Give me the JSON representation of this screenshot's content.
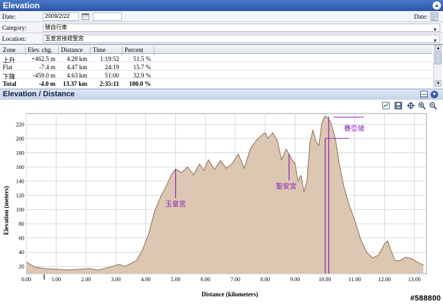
{
  "window": {
    "title": "Elevation"
  },
  "form": {
    "date_label": "Date:",
    "date_value": "2009/2/22",
    "date_right_label": "Date:",
    "category_label": "Category:",
    "category_value": "騎自行車",
    "location_label": "Location:",
    "location_value": "玉皇宮接趕聖宮"
  },
  "zones": {
    "headers": [
      "Zone",
      "Elev. chg.",
      "Distance",
      "Time",
      "Percent"
    ],
    "rows": [
      {
        "zone": "上升",
        "elev": "+462.5 m",
        "dist": "4.28 km",
        "time": "1:19:52",
        "pct": "51.5 %"
      },
      {
        "zone": "Flat",
        "elev": "-7.4 m",
        "dist": "4.47 km",
        "time": "24:19",
        "pct": "15.7 %"
      },
      {
        "zone": "下降",
        "elev": "-459.0 m",
        "dist": "4.63 km",
        "time": "51:00",
        "pct": "32.9 %"
      },
      {
        "zone": "Total",
        "elev": "-4.0 m",
        "dist": "13.37 km",
        "time": "2:35:11",
        "pct": "100.0 %"
      }
    ]
  },
  "chart_panel": {
    "title": "Elevation / Distance"
  },
  "chart_data": {
    "type": "area",
    "xlabel": "Distance (kilometers)",
    "ylabel": "Elevation (meters)",
    "xlim": [
      0,
      13.4
    ],
    "ylim": [
      10,
      235
    ],
    "x_ticks": [
      "0.00",
      "1.00",
      "2.00",
      "3.00",
      "4.00",
      "5.00",
      "6.00",
      "7.00",
      "8.00",
      "9.00",
      "10.00",
      "11.00",
      "12.00",
      "13.00"
    ],
    "y_ticks": [
      "20",
      "40",
      "60",
      "80",
      "100",
      "120",
      "140",
      "160",
      "180",
      "200",
      "220"
    ],
    "grid": true,
    "fill_color": "#dcc7b2",
    "line_color": "#8b6e52",
    "x": [
      0,
      0.3,
      0.6,
      1.0,
      1.4,
      1.8,
      2.1,
      2.4,
      2.7,
      2.9,
      3.1,
      3.3,
      3.5,
      3.7,
      3.9,
      4.1,
      4.3,
      4.5,
      4.7,
      4.85,
      5.0,
      5.2,
      5.4,
      5.6,
      5.8,
      5.95,
      6.1,
      6.3,
      6.5,
      6.7,
      6.9,
      7.1,
      7.3,
      7.5,
      7.7,
      7.9,
      8.0,
      8.1,
      8.25,
      8.4,
      8.55,
      8.7,
      8.8,
      8.9,
      9.0,
      9.1,
      9.2,
      9.3,
      9.4,
      9.5,
      9.6,
      9.7,
      9.8,
      9.9,
      10.0,
      10.1,
      10.2,
      10.35,
      10.5,
      10.65,
      10.8,
      11.0,
      11.2,
      11.4,
      11.6,
      11.8,
      11.9,
      12.0,
      12.1,
      12.2,
      12.35,
      12.5,
      12.7,
      12.9,
      13.1,
      13.3
    ],
    "y": [
      26,
      19,
      17,
      16,
      15,
      16,
      17,
      15,
      18,
      20,
      23,
      20,
      24,
      29,
      44,
      66,
      98,
      118,
      134,
      148,
      157,
      152,
      160,
      149,
      164,
      155,
      170,
      156,
      169,
      158,
      165,
      178,
      158,
      185,
      197,
      205,
      208,
      200,
      208,
      198,
      170,
      185,
      178,
      170,
      165,
      140,
      148,
      125,
      140,
      195,
      212,
      196,
      190,
      222,
      231,
      229,
      222,
      200,
      160,
      130,
      108,
      85,
      58,
      40,
      32,
      36,
      44,
      52,
      56,
      44,
      28,
      28,
      33,
      31,
      26,
      22
    ],
    "markers": [
      {
        "label": "玉皇宮",
        "x": 5.0,
        "y": 157
      },
      {
        "label": "聖安宮",
        "x": 8.8,
        "y": 178
      },
      {
        "label": "賽亞坡",
        "x": 10.15,
        "y": 231
      }
    ],
    "marker_color": "#8a1fb8"
  },
  "watermark": "#588800"
}
